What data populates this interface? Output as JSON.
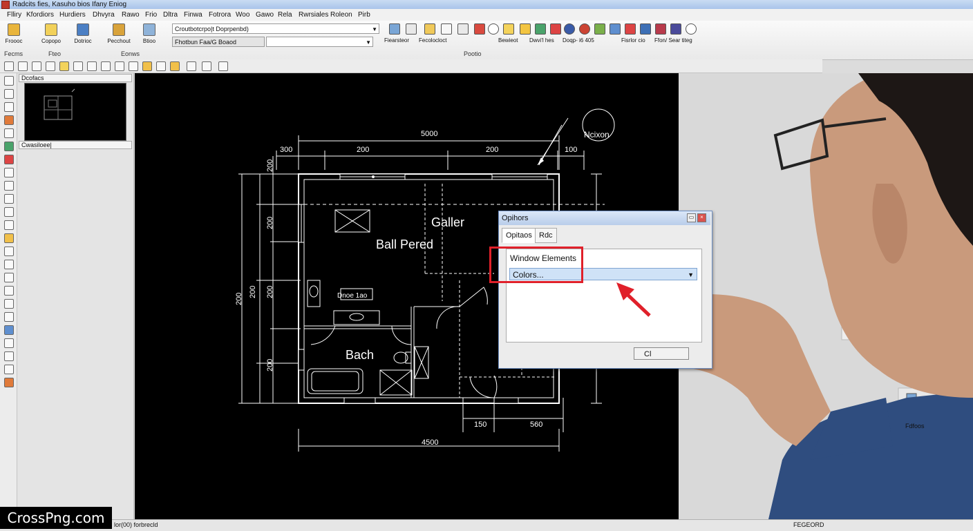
{
  "window": {
    "title": "Radcits fies, Kasuho bios Ifany Eniog"
  },
  "menu": [
    "Flliry",
    "Kfordiors",
    "Hurdiers",
    "Dhvyra",
    "Rawo",
    "Frio",
    "Dltra",
    "Finwa",
    "Fotrora",
    "Woo",
    "Gawo",
    "Rela",
    "Rwrsiales",
    "Roleon",
    "Pirb"
  ],
  "ribbon": {
    "buttons": [
      {
        "label": "Froooc"
      },
      {
        "label": "Copopo"
      },
      {
        "label": "Dotrioc"
      },
      {
        "label": "Pecchout"
      },
      {
        "label": "Btioo"
      }
    ],
    "combo_top": "Croutbotcrpo|t Doprpenbd)",
    "combo_bottom": "Fhotbun Faa/G Boaod",
    "right_labels": [
      "Fiearsteor",
      "Fecolocloct",
      "Bewieot",
      "Dwvi'l hes",
      "Doqp- i6 405",
      "Fisrlor cio",
      "Ffon/ Sear titeg"
    ],
    "group_labels": [
      "Fecms",
      "Fteo",
      "Eonws",
      "Pootio"
    ]
  },
  "panel": {
    "header": "Dcofacs",
    "footer": "Cwasiloee|"
  },
  "plan": {
    "dim_top": "5000",
    "dim_segments": [
      "300",
      "200",
      "200",
      "100"
    ],
    "dim_left": [
      "200",
      "200",
      "200",
      "200",
      "200"
    ],
    "dim_left_outer": "200",
    "dim_bottom": "4500",
    "dim_bottom_parts": [
      "150",
      "560"
    ],
    "north": "Ncixon",
    "room_galler": "Galler",
    "room_ball": "Ball Pered",
    "room_bach": "Bach",
    "fixture": "Dnoe 1ao"
  },
  "dialog": {
    "title": "Opihors",
    "tabs": [
      "Opitaos",
      "Rdc"
    ],
    "section_label": "Window Elements",
    "select_value": "Colors...",
    "ok_label": "Cl"
  },
  "right": {
    "panel_label": "Fdfoos",
    "status": "FEGEORD"
  },
  "status": {
    "left": "lor(00) forbrecld"
  },
  "watermark": "CrossPng.com",
  "colors": {
    "highlight": "#e0202a",
    "arrow": "#e0202a"
  }
}
